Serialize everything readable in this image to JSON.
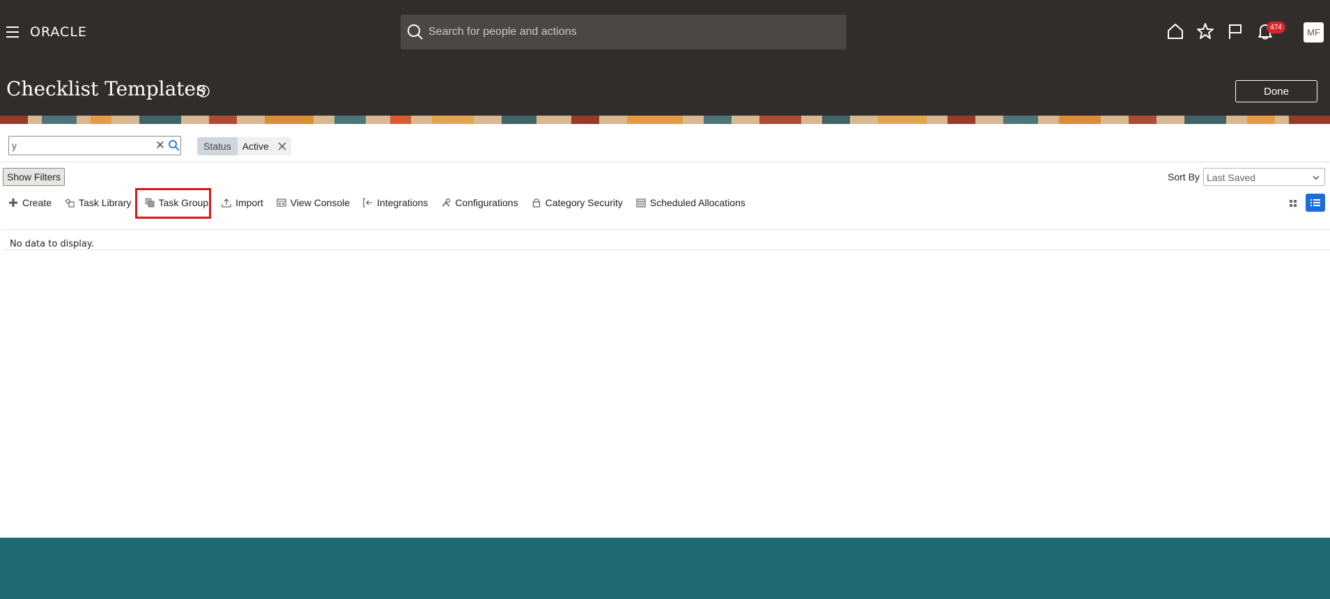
{
  "header": {
    "logo": "ORACLE",
    "search_placeholder": "Search for people and actions",
    "notification_count": "474",
    "avatar_initials": "MF",
    "page_title": "Checklist Templates",
    "done_label": "Done"
  },
  "filter": {
    "search_value": "y",
    "chip_label": "Status",
    "chip_value": "Active"
  },
  "controls": {
    "show_filters_label": "Show Filters",
    "sort_by_label": "Sort By",
    "sort_by_value": "Last Saved"
  },
  "toolbar": {
    "create": "Create",
    "task_library": "Task Library",
    "task_group": "Task Group",
    "import": "Import",
    "view_console": "View Console",
    "integrations": "Integrations",
    "configurations": "Configurations",
    "category_security": "Category Security",
    "scheduled_allocations": "Scheduled Allocations"
  },
  "results": {
    "empty_message": "No data to display."
  },
  "colors": {
    "header_bg": "#312d2a",
    "highlight": "#e01414",
    "accent_blue": "#1a6ed9",
    "footer_bg": "#1f6b72"
  }
}
